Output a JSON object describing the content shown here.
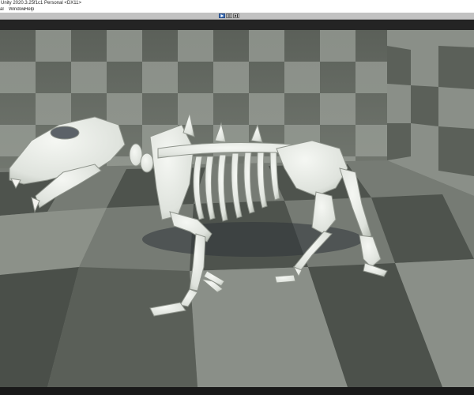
{
  "window": {
    "title": "Unity 2020.3.25f1c1 Personal <DX11>"
  },
  "menu": {
    "items": [
      "al",
      "Window",
      "Help"
    ]
  },
  "toolbar": {
    "play_state": "playing"
  },
  "colors": {
    "accent": "#3d6fb8",
    "checker_light": "#8b9089",
    "checker_dark": "#555a54",
    "bone": "#e6e9e4"
  },
  "scene": {
    "description_icon": "skeleton-model"
  }
}
